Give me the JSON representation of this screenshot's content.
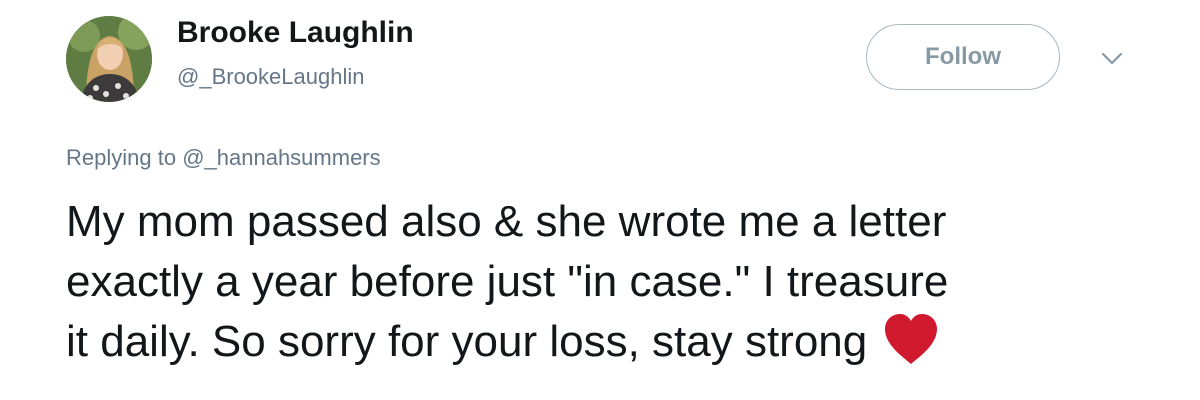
{
  "user": {
    "display_name": "Brooke Laughlin",
    "handle": "@_BrookeLaughlin",
    "avatar_icon": "profile-photo"
  },
  "actions": {
    "follow_label": "Follow",
    "menu_icon": "chevron-down-icon"
  },
  "reply": {
    "prefix": "Replying to",
    "mention": "@_hannahsummers"
  },
  "tweet": {
    "lines": [
      "My mom passed also & she wrote me a letter",
      "exactly a year before just \"in case.\" I treasure",
      "it daily. So sorry for your loss, stay strong"
    ],
    "emoji": "red-heart-icon"
  },
  "colors": {
    "text_primary": "#14171a",
    "text_secondary": "#657786",
    "follow_border": "#aab8c2",
    "heart": "#d0182f"
  }
}
